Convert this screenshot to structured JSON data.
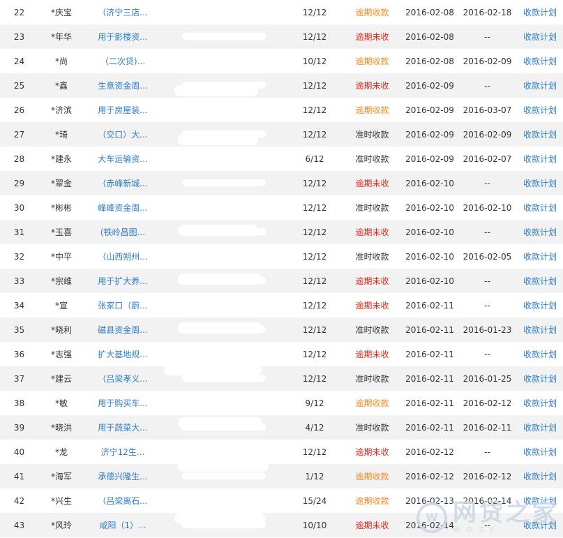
{
  "rows": [
    {
      "no": "22",
      "name": "*庆宝",
      "purpose": "（济宁三店...",
      "period": "12/12",
      "status": "逾期收款",
      "status_type": "orange",
      "due": "2016-02-08",
      "paid": "2016-02-18",
      "plan": "收款计划"
    },
    {
      "no": "23",
      "name": "*年华",
      "purpose": "用于影楼资...",
      "period": "12/12",
      "status": "逾期未收",
      "status_type": "red",
      "due": "2016-02-08",
      "paid": "--",
      "plan": "收款计划"
    },
    {
      "no": "24",
      "name": "*尚",
      "purpose": "（二次贷)...",
      "period": "10/12",
      "status": "逾期收款",
      "status_type": "orange",
      "due": "2016-02-08",
      "paid": "2016-02-09",
      "plan": "收款计划"
    },
    {
      "no": "25",
      "name": "*鑫",
      "purpose": "生意资金周...",
      "period": "12/12",
      "status": "逾期未收",
      "status_type": "red",
      "due": "2016-02-09",
      "paid": "--",
      "plan": "收款计划"
    },
    {
      "no": "26",
      "name": "*济滨",
      "purpose": "用于房屋装...",
      "period": "12/12",
      "status": "逾期收款",
      "status_type": "orange",
      "due": "2016-02-09",
      "paid": "2016-03-07",
      "plan": "收款计划"
    },
    {
      "no": "27",
      "name": "*琦",
      "purpose": "（交口）大...",
      "period": "12/12",
      "status": "准时收款",
      "status_type": "normal",
      "due": "2016-02-09",
      "paid": "2016-02-09",
      "plan": "收款计划"
    },
    {
      "no": "28",
      "name": "*建永",
      "purpose": "大车运输资...",
      "period": "6/12",
      "status": "准时收款",
      "status_type": "normal",
      "due": "2016-02-09",
      "paid": "2016-02-07",
      "plan": "收款计划"
    },
    {
      "no": "29",
      "name": "*翠金",
      "purpose": "（赤峰新城...",
      "period": "12/12",
      "status": "逾期未收",
      "status_type": "red",
      "due": "2016-02-10",
      "paid": "--",
      "plan": "收款计划"
    },
    {
      "no": "30",
      "name": "*彬彬",
      "purpose": "峰峰资金周...",
      "period": "12/12",
      "status": "准时收款",
      "status_type": "normal",
      "due": "2016-02-10",
      "paid": "2016-02-10",
      "plan": "收款计划"
    },
    {
      "no": "31",
      "name": "*玉喜",
      "purpose": "(铁岭昌图...",
      "period": "12/12",
      "status": "逾期未收",
      "status_type": "red",
      "due": "2016-02-10",
      "paid": "--",
      "plan": "收款计划"
    },
    {
      "no": "32",
      "name": "*中平",
      "purpose": "（山西朔州...",
      "period": "12/12",
      "status": "准时收款",
      "status_type": "normal",
      "due": "2016-02-10",
      "paid": "2016-02-05",
      "plan": "收款计划"
    },
    {
      "no": "33",
      "name": "*宗维",
      "purpose": "用于扩大养...",
      "period": "12/12",
      "status": "逾期未收",
      "status_type": "red",
      "due": "2016-02-10",
      "paid": "--",
      "plan": "收款计划"
    },
    {
      "no": "34",
      "name": "*宣",
      "purpose": "张家口（蔚...",
      "period": "12/12",
      "status": "逾期未收",
      "status_type": "red",
      "due": "2016-02-11",
      "paid": "--",
      "plan": "收款计划"
    },
    {
      "no": "35",
      "name": "*晓利",
      "purpose": "磁县资金周...",
      "period": "12/12",
      "status": "准时收款",
      "status_type": "normal",
      "due": "2016-02-11",
      "paid": "2016-01-23",
      "plan": "收款计划"
    },
    {
      "no": "36",
      "name": "*志强",
      "purpose": "扩大基地规...",
      "period": "12/12",
      "status": "逾期未收",
      "status_type": "red",
      "due": "2016-02-11",
      "paid": "--",
      "plan": "收款计划"
    },
    {
      "no": "37",
      "name": "*建云",
      "purpose": "（吕梁孝义...",
      "period": "12/12",
      "status": "准时收款",
      "status_type": "normal",
      "due": "2016-02-11",
      "paid": "2016-01-25",
      "plan": "收款计划"
    },
    {
      "no": "38",
      "name": "*敏",
      "purpose": "用于购买车...",
      "period": "9/12",
      "status": "逾期收款",
      "status_type": "orange",
      "due": "2016-02-11",
      "paid": "2016-02-12",
      "plan": "收款计划"
    },
    {
      "no": "39",
      "name": "*晓洪",
      "purpose": "用于蔬菜大...",
      "period": "4/12",
      "status": "准时收款",
      "status_type": "normal",
      "due": "2016-02-11",
      "paid": "2016-02-11",
      "plan": "收款计划"
    },
    {
      "no": "40",
      "name": "*龙",
      "purpose": "济宁12生...",
      "period": "12/12",
      "status": "逾期未收",
      "status_type": "red",
      "due": "2016-02-12",
      "paid": "--",
      "plan": "收款计划"
    },
    {
      "no": "41",
      "name": "*海军",
      "purpose": "承德兴隆生...",
      "period": "1/12",
      "status": "逾期收款",
      "status_type": "orange",
      "due": "2016-02-12",
      "paid": "2016-02-12",
      "plan": "收款计划"
    },
    {
      "no": "42",
      "name": "*兴生",
      "purpose": "（吕梁离石...",
      "period": "15/24",
      "status": "逾期收款",
      "status_type": "orange",
      "due": "2016-02-13",
      "paid": "2016-02-14",
      "plan": "收款计划"
    },
    {
      "no": "43",
      "name": "*风玲",
      "purpose": "咸阳（1）...",
      "period": "10/10",
      "status": "逾期未收",
      "status_type": "red",
      "due": "2016-02-14",
      "paid": "--",
      "plan": "收款计划"
    }
  ],
  "watermark": {
    "main": "网贷之家",
    "sub": "WDZJ",
    "logo": "wdzj-logo-icon"
  },
  "colors": {
    "link": "#2d7dc4",
    "overdue_paid": "#f08a1c",
    "overdue_unpaid": "#e0261b",
    "row_alt": "#f2f2f2"
  }
}
